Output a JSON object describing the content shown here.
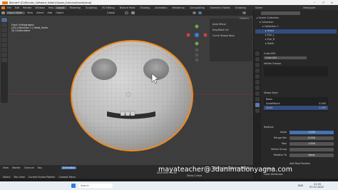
{
  "titlebar": {
    "title": "Blender* [D:\\Blender_Software_folder\\Classes_Exercise\\faces\\blend]"
  },
  "menubar": {
    "menus": [
      "File",
      "Edit",
      "Render",
      "Window",
      "Help"
    ],
    "workspaces": [
      "Layout",
      "Modeling",
      "Sculpting",
      "UV Editing",
      "Texture Paint",
      "Shading",
      "Animation",
      "Rendering",
      "Compositing",
      "Geometry Nodes",
      "Scripting"
    ],
    "active_workspace": "Layout",
    "scene": "Scene",
    "view_layer": "ViewLayer"
  },
  "viewport": {
    "mode": "Object Mode",
    "menus": [
      "View",
      "Select",
      "Add",
      "Object"
    ],
    "transform": "Global",
    "info_lines": [
      "Front Orthographic",
      "(25) Collection 1 | Head_Smile",
      "10 Centimeters"
    ],
    "options_label": "Options",
    "n_panel": [
      "Auto Mirror",
      "EasyMesh VV",
      "Curve Shape Keys"
    ]
  },
  "outliner": {
    "items": [
      "Scene Collection",
      "Collection",
      "Collection 1",
      "Head",
      "Eye_L",
      "Eye_R",
      "Teeth"
    ]
  },
  "properties": {
    "object_name": "Cube.003",
    "object_field": "Cube.003",
    "sections": {
      "vertex_groups": "Vertex Groups",
      "shape_keys": "Shape Keys",
      "relative": "Relative",
      "uv_maps": "UV Maps",
      "color_attributes": "Color Attributes"
    },
    "shape_keys": [
      {
        "name": "Basis",
        "value": ""
      },
      {
        "name": "ScaleMouth",
        "value": "0.000"
      },
      {
        "name": "Smile",
        "value": "1.000"
      }
    ],
    "fields": [
      {
        "label": "Value",
        "value": "1.000",
        "highlight": true
      },
      {
        "label": "Range Min",
        "value": "0.000",
        "highlight": false
      },
      {
        "label": "Max",
        "value": "1.000",
        "highlight": false
      },
      {
        "label": "Vertex Group",
        "value": "",
        "highlight": false
      },
      {
        "label": "Relative To",
        "value": "Basis",
        "highlight": false
      }
    ],
    "add_rest_position": "Add Rest Position"
  },
  "timeline": {
    "menus": [
      "View",
      "Marker",
      "Channel",
      "Key"
    ],
    "animation_label": "Animation",
    "frame_current": "5",
    "start_label": "Start",
    "start": "1",
    "end_label": "End",
    "end": "250",
    "status_items": [
      "Select",
      "Pan View",
      "Current Frame Pattern",
      "Context Menu"
    ],
    "playback_labels": [
      "Keyframe Frame",
      "Show Cursor"
    ]
  },
  "watermark": "mayateacher@3danimationyagna.com",
  "taskbar": {
    "search_placeholder": "Search",
    "time": "21:33",
    "date": "07-07-2023",
    "language": "ENG"
  }
}
